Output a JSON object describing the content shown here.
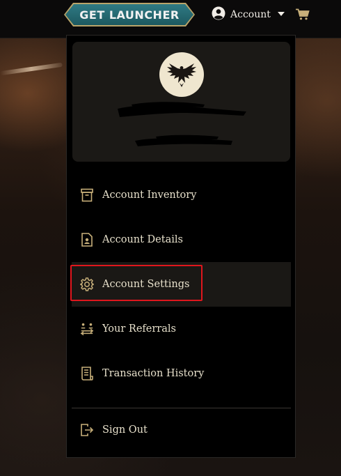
{
  "header": {
    "launcher_label": "GET LAUNCHER",
    "account_label": "Account",
    "icons": [
      "user-circle-icon",
      "chevron-down-icon",
      "cart-icon"
    ]
  },
  "dropdown": {
    "items": [
      {
        "label": "Account Inventory",
        "icon": "archive-box-icon"
      },
      {
        "label": "Account Details",
        "icon": "user-document-icon"
      },
      {
        "label": "Account Settings",
        "icon": "gear-icon",
        "active": true
      },
      {
        "label": "Your Referrals",
        "icon": "referrals-icon"
      },
      {
        "label": "Transaction History",
        "icon": "receipt-icon"
      }
    ],
    "sign_out_label": "Sign Out",
    "sign_out_icon": "sign-out-icon"
  },
  "colors": {
    "accent_gold": "#c8b07a",
    "launcher_teal": "#1d5960",
    "highlight_red": "#e0161d"
  }
}
